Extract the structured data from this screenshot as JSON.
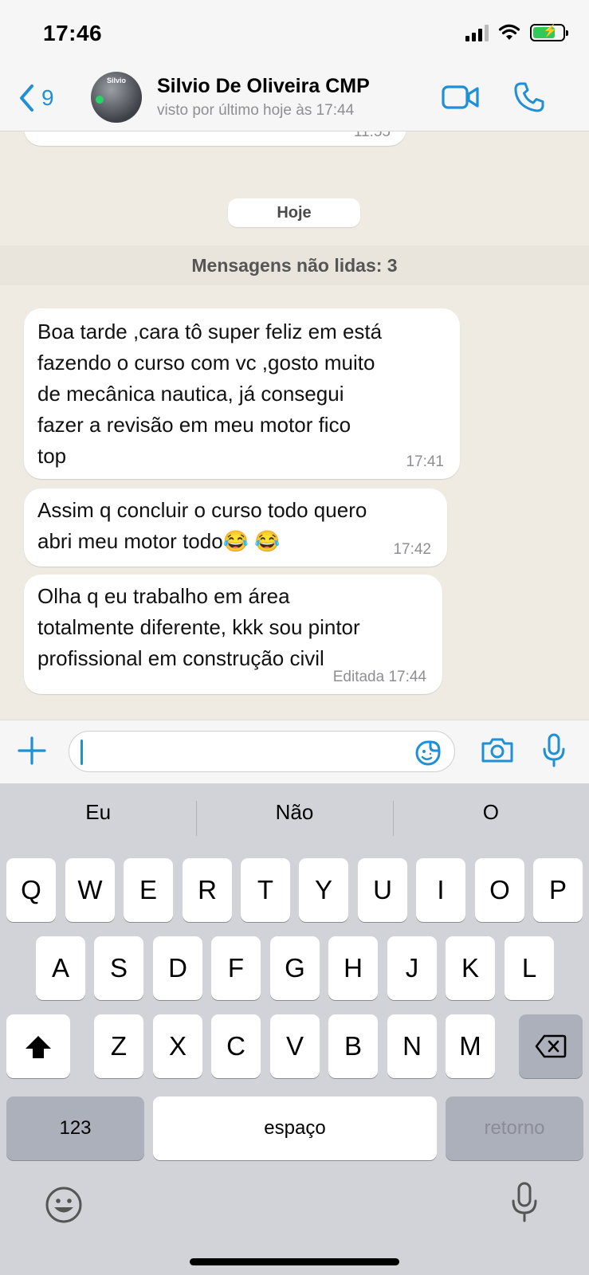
{
  "status_bar": {
    "time": "17:46",
    "battery_percent": 75
  },
  "header": {
    "back_count": "9",
    "contact_name": "Silvio De Oliveira CMP",
    "contact_status": "visto por último hoje às 17:44",
    "avatar_text": "Silvio"
  },
  "chat": {
    "partial_time": "11:55",
    "date_label": "Hoje",
    "unread_label": "Mensagens não lidas: 3",
    "messages": [
      {
        "text": "Boa tarde ,cara tô super feliz em está\nfazendo o curso com vc ,gosto muito\nde mecânica nautica, já consegui\nfazer a revisão em meu motor fico\ntop",
        "time": "17:41"
      },
      {
        "text": "Assim q concluir o curso todo quero\nabri meu motor todo😂 😂",
        "time": "17:42"
      },
      {
        "text": "Olha q eu trabalho  em área\ntotalmente diferente, kkk sou pintor\nprofissional em construção civil",
        "time": "Editada 17:44"
      }
    ]
  },
  "input": {
    "value": ""
  },
  "keyboard": {
    "suggestions": [
      "Eu",
      "Não",
      "O"
    ],
    "row1": [
      "Q",
      "W",
      "E",
      "R",
      "T",
      "Y",
      "U",
      "I",
      "O",
      "P"
    ],
    "row2": [
      "A",
      "S",
      "D",
      "F",
      "G",
      "H",
      "J",
      "K",
      "L"
    ],
    "row3": [
      "Z",
      "X",
      "C",
      "V",
      "B",
      "N",
      "M"
    ],
    "numbers_label": "123",
    "space_label": "espaço",
    "return_label": "retorno"
  },
  "colors": {
    "accent": "#1f8fd6",
    "battery": "#34c759",
    "chat_bg": "#efeae2"
  }
}
